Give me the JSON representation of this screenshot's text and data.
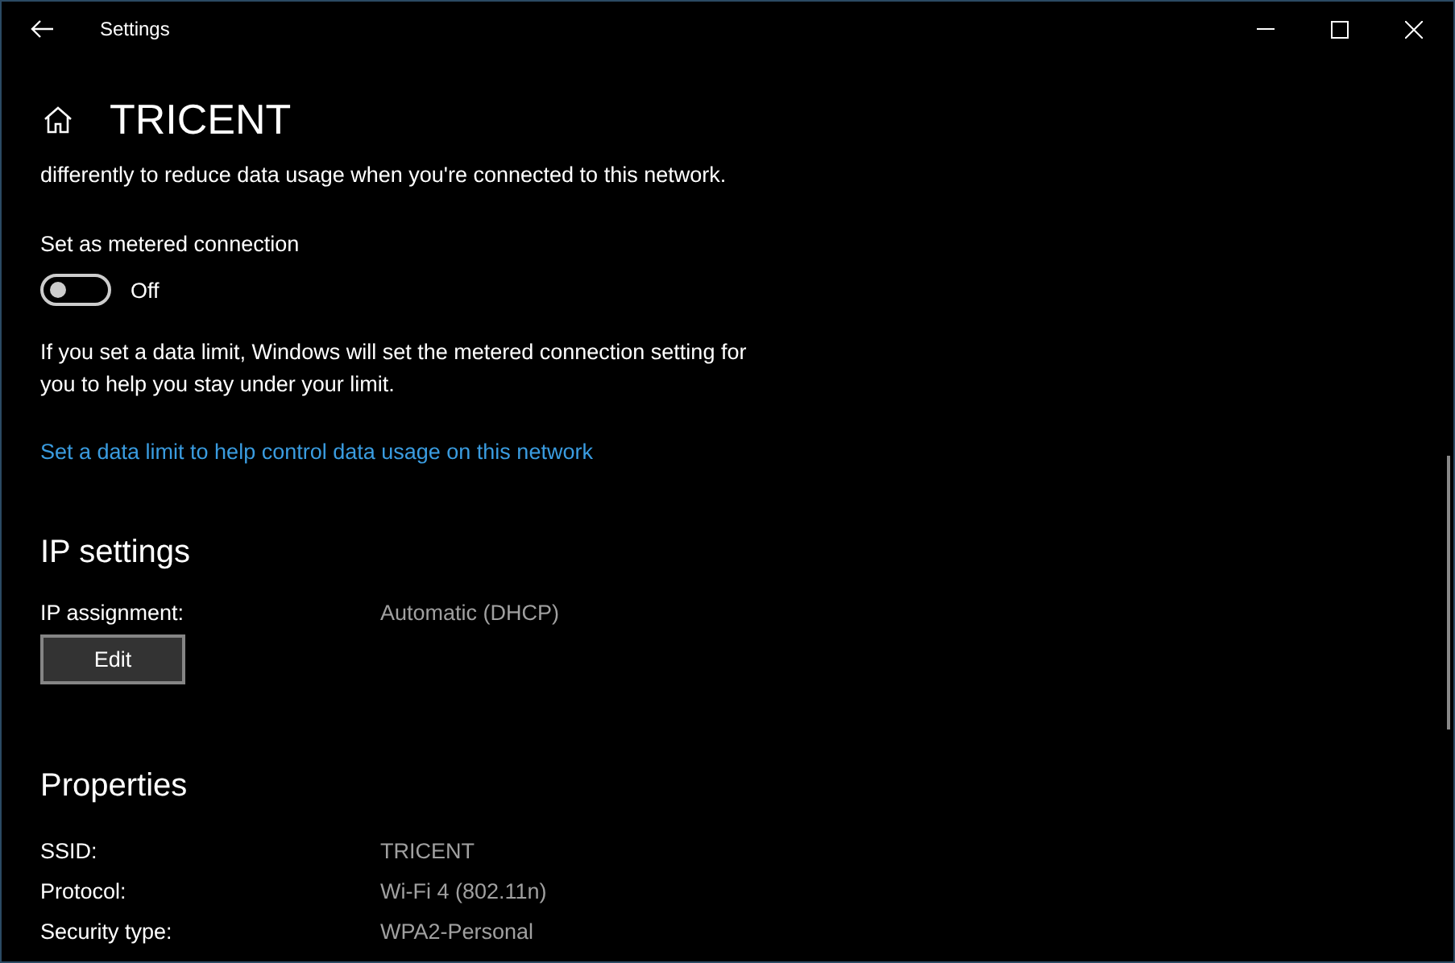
{
  "window": {
    "title": "Settings"
  },
  "page": {
    "title": "TRICENT"
  },
  "metered": {
    "description": "differently to reduce data usage when you're connected to this network.",
    "label": "Set as metered connection",
    "toggle": {
      "on": false,
      "state_label": "Off"
    },
    "note": "If you set a data limit, Windows will set the metered connection setting for you to help you stay under your limit.",
    "link": "Set a data limit to help control data usage on this network"
  },
  "ip_settings": {
    "heading": "IP settings",
    "rows": [
      {
        "label": "IP assignment:",
        "value": "Automatic (DHCP)"
      }
    ],
    "button": "Edit"
  },
  "properties": {
    "heading": "Properties",
    "rows": [
      {
        "label": "SSID:",
        "value": "TRICENT"
      },
      {
        "label": "Protocol:",
        "value": "Wi-Fi 4 (802.11n)"
      },
      {
        "label": "Security type:",
        "value": "WPA2-Personal"
      }
    ]
  }
}
